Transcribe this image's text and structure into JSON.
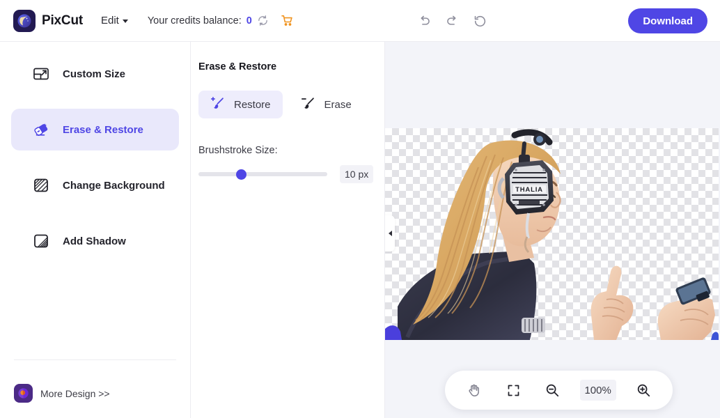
{
  "header": {
    "brand_name": "PixCut",
    "logo_icon": "pixcut-moon-logo",
    "edit_menu_label": "Edit",
    "credits_label": "Your credits balance:",
    "credits_value": "0",
    "refresh_icon": "refresh-icon",
    "cart_icon": "shopping-cart-icon",
    "tools": [
      {
        "name": "undo-icon",
        "title": "Undo"
      },
      {
        "name": "redo-icon",
        "title": "Redo"
      },
      {
        "name": "reset-icon",
        "title": "Reset"
      }
    ],
    "download_label": "Download"
  },
  "sidebar": {
    "items": [
      {
        "label": "Custom Size",
        "icon": "custom-size-icon",
        "active": false
      },
      {
        "label": "Erase & Restore",
        "icon": "erase-restore-icon",
        "active": true
      },
      {
        "label": "Change Background",
        "icon": "change-background-icon",
        "active": false
      },
      {
        "label": "Add Shadow",
        "icon": "add-shadow-icon",
        "active": false
      }
    ],
    "more_design_label": "More Design >>",
    "more_design_icon": "more-design-logo"
  },
  "panel": {
    "title": "Erase & Restore",
    "modes": [
      {
        "label": "Restore",
        "icon": "brush-plus-icon",
        "active": true
      },
      {
        "label": "Erase",
        "icon": "brush-minus-icon",
        "active": false
      }
    ],
    "brush_label": "Brushstroke Size:",
    "brush_value": "10 px",
    "brush_percent": 32
  },
  "canvas": {
    "collapse_icon": "collapse-left-arrow-icon",
    "image_alt": "woman-with-headphones-cutout",
    "headphone_brand_text": "THALIA",
    "zoom_bar": {
      "hand_icon": "hand-tool-icon",
      "fit_icon": "fit-to-screen-icon",
      "zoom_out_icon": "zoom-out-icon",
      "zoom_level": "100%",
      "zoom_in_icon": "zoom-in-icon"
    }
  },
  "colors": {
    "accent": "#4f46e5",
    "accent_soft": "#e9e8fb",
    "cart": "#f59e0b",
    "canvas_bg": "#f3f4f9"
  }
}
